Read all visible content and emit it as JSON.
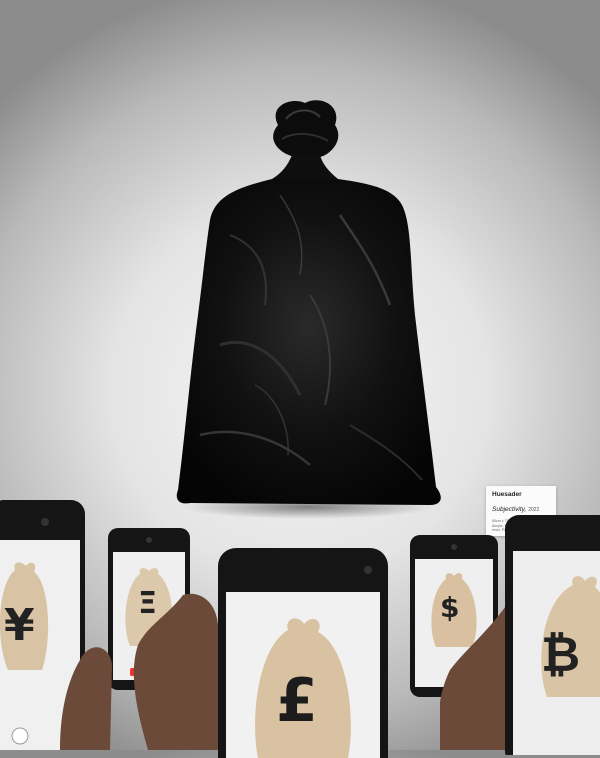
{
  "artwork": {
    "subject": "black-trash-bag-sculpture"
  },
  "placard": {
    "artist": "Huesader",
    "title": "Subjectivity,",
    "year": "2022",
    "specs": "50cm x 75cm x 40cm\nAcrylic, Polyurethane\nresin, Plastic film."
  },
  "phones": [
    {
      "symbol": "¥",
      "currency": "yen",
      "bag_color": "#d8c3a5"
    },
    {
      "symbol": "Ξ",
      "currency": "ethereum",
      "bag_color": "#dcc8ab"
    },
    {
      "symbol": "£",
      "currency": "pound",
      "bag_color": "#d9c2a1"
    },
    {
      "symbol": "$",
      "currency": "dollar",
      "bag_color": "#d8c0a0"
    },
    {
      "symbol": "₿",
      "currency": "bitcoin",
      "bag_color": "#dac4a6"
    }
  ],
  "colors": {
    "background": "#e4e4e4",
    "bag": "#0a0a0a",
    "phone_body": "#151515",
    "money_bag": "#d9c2a1",
    "skin": "#6b4a3a"
  }
}
